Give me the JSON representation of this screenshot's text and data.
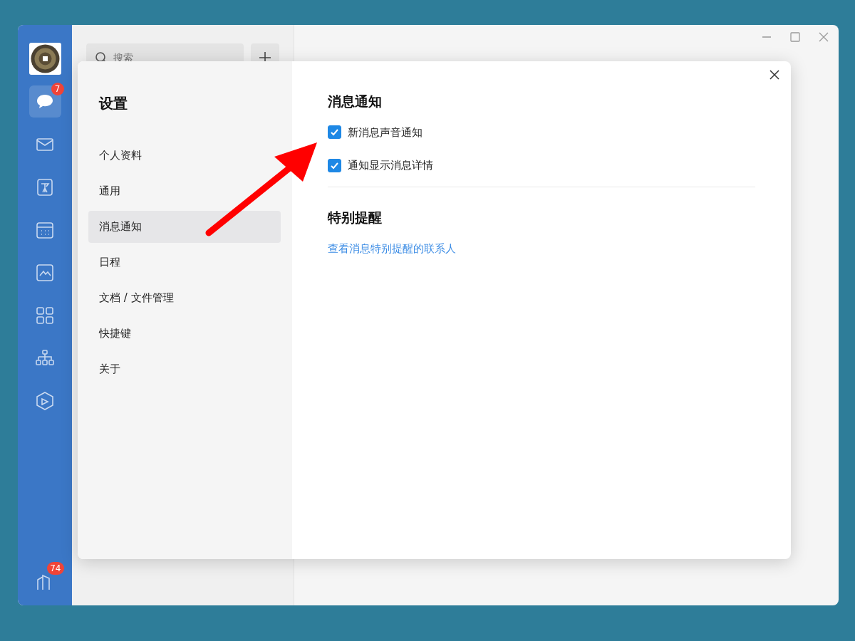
{
  "sidebar": {
    "items": [
      {
        "selected": true,
        "badge": "7"
      },
      {
        "selected": false
      },
      {
        "selected": false
      },
      {
        "selected": false
      },
      {
        "selected": false
      },
      {
        "selected": false
      },
      {
        "selected": false
      },
      {
        "selected": false
      }
    ],
    "bottom_badge": "74"
  },
  "search": {
    "placeholder": "搜索"
  },
  "dialog": {
    "title": "设置",
    "menu": [
      {
        "label": "个人资料",
        "selected": false
      },
      {
        "label": "通用",
        "selected": false
      },
      {
        "label": "消息通知",
        "selected": true
      },
      {
        "label": "日程",
        "selected": false
      },
      {
        "label": "文档 / 文件管理",
        "selected": false
      },
      {
        "label": "快捷键",
        "selected": false
      },
      {
        "label": "关于",
        "selected": false
      }
    ],
    "sections": [
      {
        "heading": "消息通知",
        "options": [
          {
            "label": "新消息声音通知",
            "checked": true
          },
          {
            "label": "通知显示消息详情",
            "checked": true
          }
        ]
      },
      {
        "heading": "特别提醒",
        "link": "查看消息特别提醒的联系人"
      }
    ]
  }
}
